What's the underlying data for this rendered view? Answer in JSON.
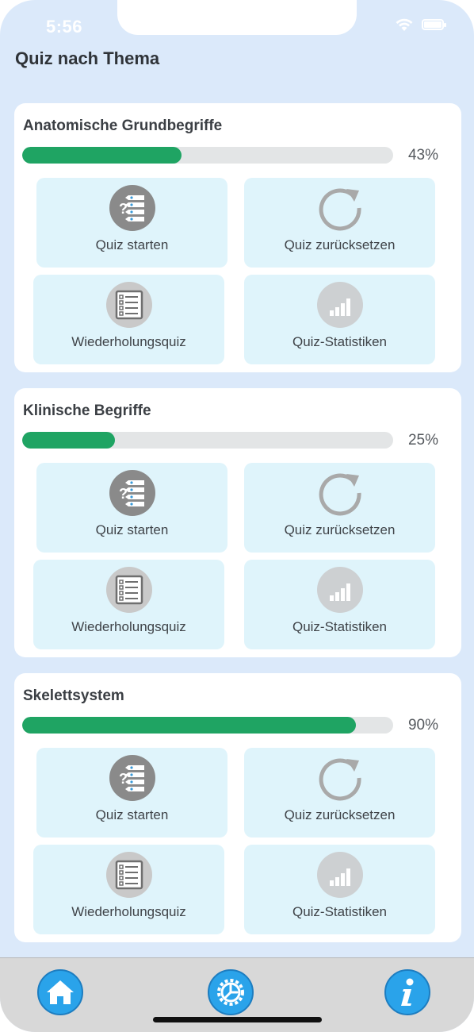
{
  "status_bar": {
    "time": "5:56"
  },
  "header": {
    "title": "Quiz nach Thema"
  },
  "topics": [
    {
      "title": "Anatomische Grundbegriffe",
      "progress_percent": 43,
      "progress_label": "43%",
      "actions": {
        "start": "Quiz starten",
        "reset": "Quiz zurücksetzen",
        "review": "Wiederholungsquiz",
        "stats": "Quiz-Statistiken"
      }
    },
    {
      "title": "Klinische Begriffe",
      "progress_percent": 25,
      "progress_label": "25%",
      "actions": {
        "start": "Quiz starten",
        "reset": "Quiz zurücksetzen",
        "review": "Wiederholungsquiz",
        "stats": "Quiz-Statistiken"
      }
    },
    {
      "title": "Skelettsystem",
      "progress_percent": 90,
      "progress_label": "90%",
      "actions": {
        "start": "Quiz starten",
        "reset": "Quiz zurücksetzen",
        "review": "Wiederholungsquiz",
        "stats": "Quiz-Statistiken"
      }
    }
  ],
  "tab_bar": {
    "items": [
      {
        "icon": "home-icon"
      },
      {
        "icon": "gear-icon"
      },
      {
        "icon": "info-icon"
      }
    ]
  },
  "colors": {
    "background": "#dbe9fa",
    "progress": "#1fa463",
    "tile": "#dff4fb",
    "tab_button": "#2aa3ea"
  }
}
